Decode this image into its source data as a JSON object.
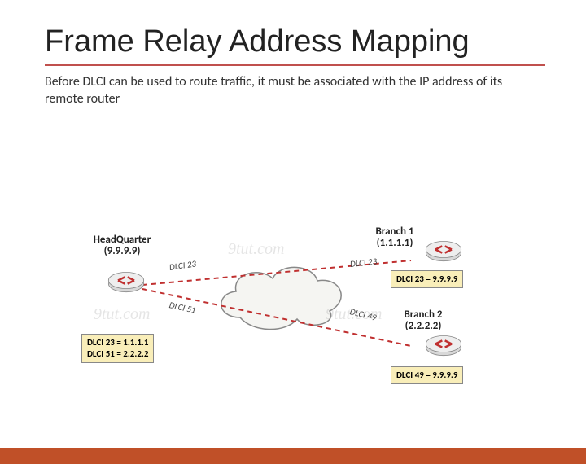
{
  "title": "Frame Relay Address Mapping",
  "subtitle": "Before DLCI can be used to route traffic, it must be associated with the IP address of its remote router",
  "hq": {
    "name": "HeadQuarter",
    "ip": "(9.9.9.9)"
  },
  "b1": {
    "name": "Branch 1",
    "ip": "(1.1.1.1)"
  },
  "b2": {
    "name": "Branch 2",
    "ip": "(2.2.2.2)"
  },
  "dlci": {
    "hq_top": "DLCI 23",
    "hq_bot": "DLCI 51",
    "b1": "DLCI 23",
    "b2": "DLCI 49"
  },
  "maps": {
    "hq_line1": "DLCI 23 = 1.1.1.1",
    "hq_line2": "DLCI 51 = 2.2.2.2",
    "b1": "DLCI 23 = 9.9.9.9",
    "b2": "DLCI 49 = 9.9.9.9"
  },
  "watermark": "9tut.com"
}
